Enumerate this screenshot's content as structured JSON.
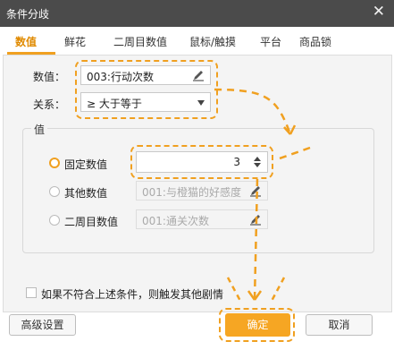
{
  "window": {
    "title": "条件分歧",
    "close_symbol": "✕"
  },
  "tabs": [
    {
      "label": "数值",
      "active": true
    },
    {
      "label": "鲜花"
    },
    {
      "label": "二周目数值"
    },
    {
      "label": "鼠标/触摸"
    },
    {
      "label": "平台"
    },
    {
      "label": "商品锁"
    }
  ],
  "form": {
    "value_label": "数值：",
    "value_field": "003:行动次数",
    "relation_label": "关系：",
    "relation_value": "≥ 大于等于"
  },
  "value_group": {
    "title": "值",
    "options": [
      {
        "label": "固定数值",
        "value": "3",
        "checked": true
      },
      {
        "label": "其他数值",
        "value": "001:与橙猫的好感度",
        "checked": false
      },
      {
        "label": "二周目数值",
        "value": "001:通关次数",
        "checked": false
      }
    ]
  },
  "else_checkbox": {
    "label": "如果不符合上述条件，则触发其他剧情",
    "checked": false
  },
  "buttons": {
    "advanced": "高级设置",
    "ok": "确定",
    "cancel": "取消"
  },
  "colors": {
    "accent": "#f6a623",
    "titlebar": "#4b4b4b",
    "annotation": "#f0a020"
  }
}
